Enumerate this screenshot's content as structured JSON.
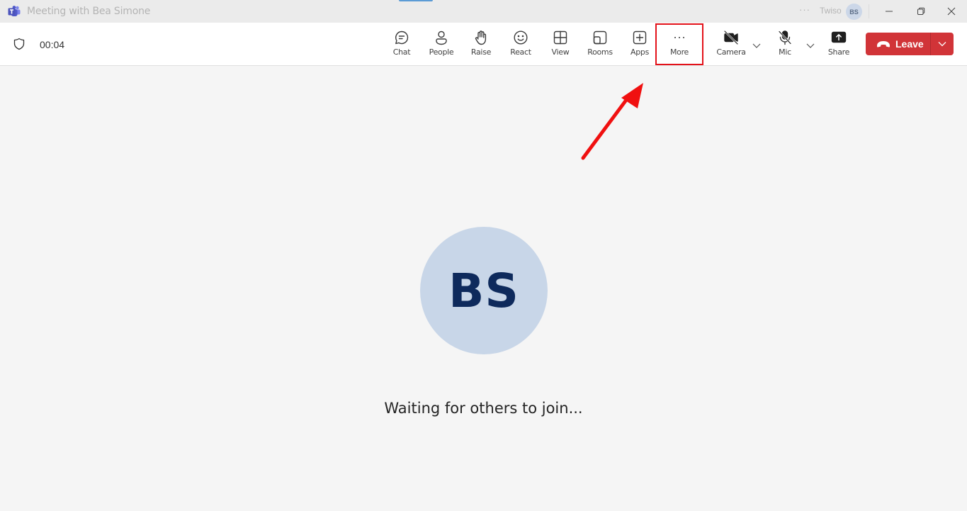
{
  "window": {
    "title": "Meeting with Bea Simone",
    "app_icon": "microsoft-teams-icon",
    "more_label": "···",
    "org_name": "Twiso",
    "account_initials": "BS",
    "controls": [
      "minimize",
      "restore",
      "close"
    ]
  },
  "meeting_bar": {
    "security_icon": "shield-icon",
    "elapsed_time": "00:04",
    "tools": [
      {
        "id": "chat",
        "label": "Chat",
        "icon": "chat-bubble-icon"
      },
      {
        "id": "people",
        "label": "People",
        "icon": "person-icon"
      },
      {
        "id": "raise",
        "label": "Raise",
        "icon": "raise-hand-icon"
      },
      {
        "id": "react",
        "label": "React",
        "icon": "smiley-icon"
      },
      {
        "id": "view",
        "label": "View",
        "icon": "grid-view-icon"
      },
      {
        "id": "rooms",
        "label": "Rooms",
        "icon": "breakout-rooms-icon"
      },
      {
        "id": "apps",
        "label": "Apps",
        "icon": "add-app-icon"
      },
      {
        "id": "more",
        "label": "More",
        "icon": "more-dots-icon",
        "highlighted": true
      },
      {
        "id": "camera",
        "label": "Camera",
        "icon": "camera-off-icon",
        "state": "off"
      },
      {
        "id": "mic",
        "label": "Mic",
        "icon": "mic-off-icon",
        "state": "muted"
      },
      {
        "id": "share",
        "label": "Share",
        "icon": "share-screen-icon"
      }
    ],
    "leave": {
      "label": "Leave",
      "icon": "hang-up-icon",
      "color": "#d13438"
    }
  },
  "stage": {
    "participant_initials": "BS",
    "participant_name": "Bea Simone",
    "avatar_bg": "#c8d6e8",
    "initials_color": "#0e2a5c",
    "status_text": "Waiting for others to join..."
  },
  "annotation": {
    "type": "arrow-and-box",
    "target": "more",
    "color": "#e3121a"
  }
}
